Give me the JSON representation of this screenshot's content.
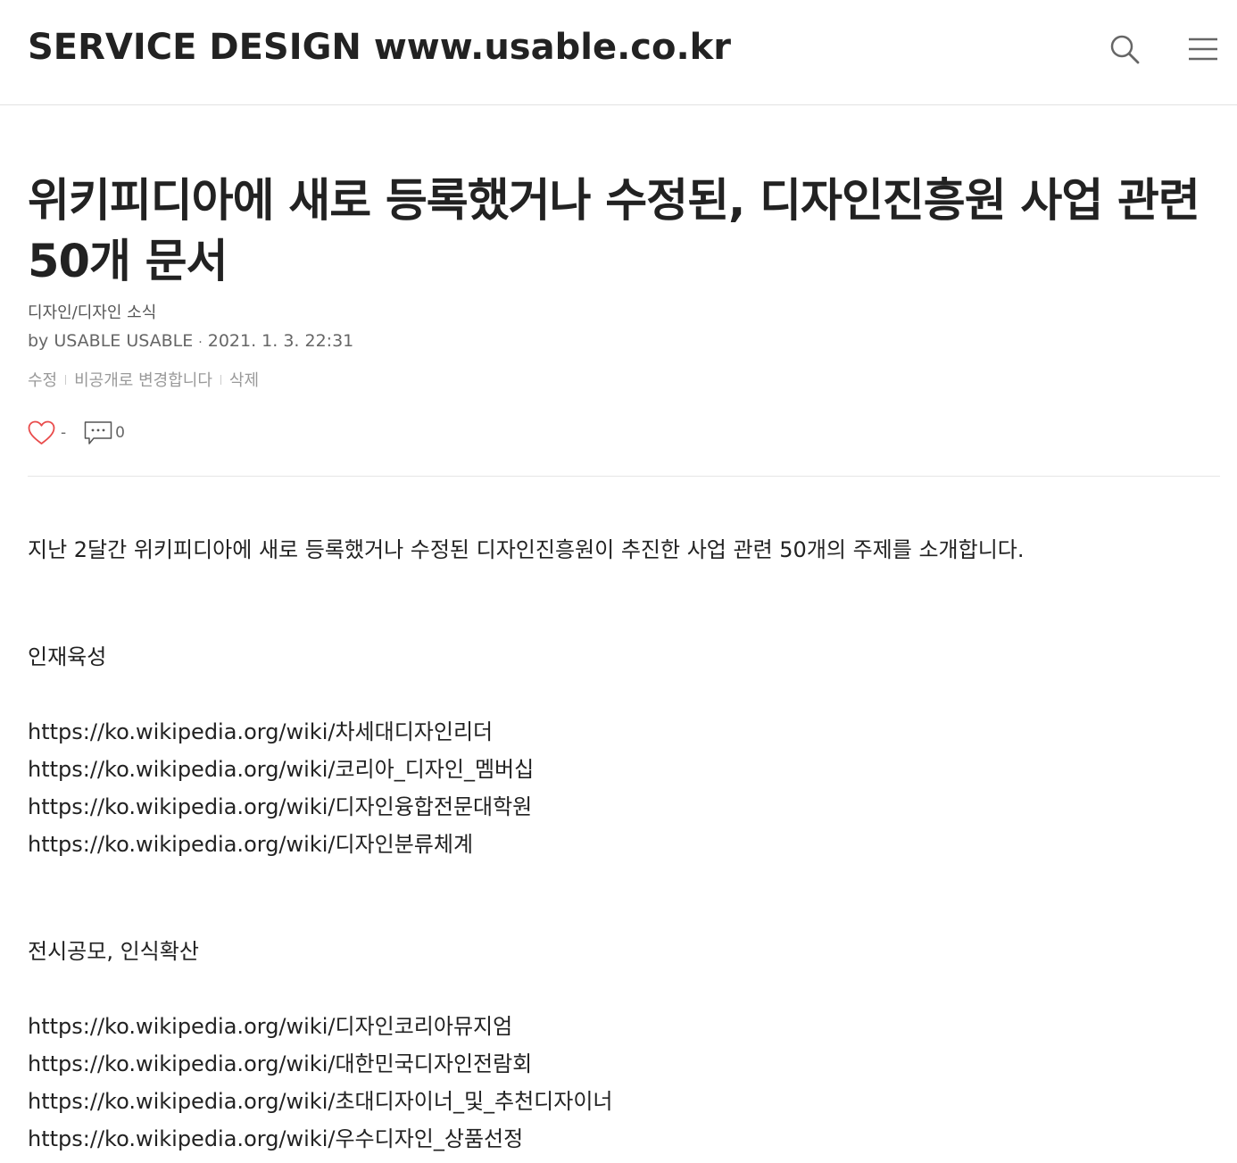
{
  "header": {
    "site_title": "SERVICE DESIGN www.usable.co.kr",
    "search_icon": "search-icon",
    "menu_icon": "hamburger-menu-icon"
  },
  "post": {
    "title": "위키피디아에 새로 등록했거나 수정된, 디자인진흥원 사업 관련 50개 문서",
    "category": "디자인/디자인 소식",
    "author": "by USABLE USABLE",
    "separator": "·",
    "date": "2021. 1. 3. 22:31",
    "admin": {
      "edit": "수정",
      "make_private": "비공개로 변경합니다",
      "delete": "삭제"
    },
    "likes": "-",
    "comments": "0",
    "like_icon": "heart-icon",
    "comment_icon": "comment-icon"
  },
  "content": {
    "intro": "지난 2달간 위키피디아에 새로 등록했거나 수정된 디자인진흥원이 추진한 사업 관련 50개의 주제를 소개합니다.",
    "sections": [
      {
        "heading": "인재육성",
        "links": [
          "https://ko.wikipedia.org/wiki/차세대디자인리더",
          "https://ko.wikipedia.org/wiki/코리아_디자인_멤버십",
          "https://ko.wikipedia.org/wiki/디자인융합전문대학원",
          "https://ko.wikipedia.org/wiki/디자인분류체계"
        ]
      },
      {
        "heading": "전시공모, 인식확산",
        "links": [
          "https://ko.wikipedia.org/wiki/디자인코리아뮤지엄",
          "https://ko.wikipedia.org/wiki/대한민국디자인전람회",
          "https://ko.wikipedia.org/wiki/초대디자이너_및_추천디자이너",
          "https://ko.wikipedia.org/wiki/우수디자인_상품선정"
        ]
      }
    ]
  }
}
